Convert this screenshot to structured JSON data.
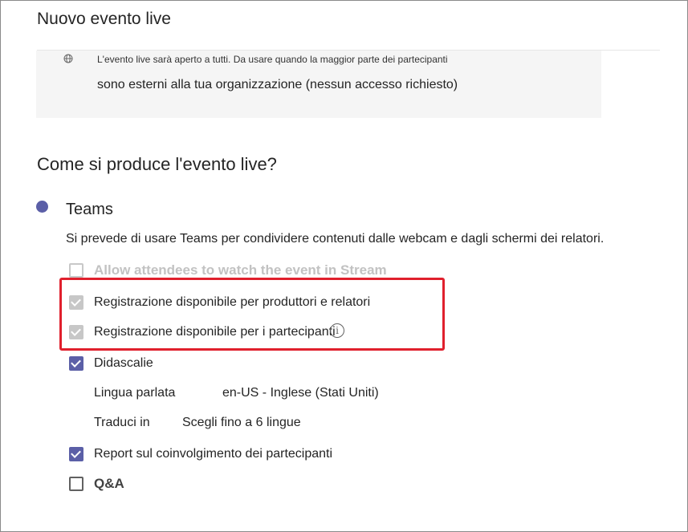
{
  "window": {
    "title": "Nuovo evento live"
  },
  "permissions": {
    "icon": "globe-icon",
    "description_line1": "L'evento live sarà aperto a tutti. Da usare quando la maggior parte dei partecipanti",
    "description_line2": "sono esterni alla tua organizzazione (nessun accesso richiesto)"
  },
  "production": {
    "heading": "Come si produce l'evento live?",
    "selected_option": "Teams",
    "description": "Si prevede di usare Teams per condividere contenuti dalle webcam e dagli schermi dei relatori.",
    "options": {
      "stream": {
        "label": "Allow attendees to watch the event in Stream",
        "checked": false,
        "disabled": true
      },
      "recording_producers": {
        "label": "Registrazione disponibile per produttori e relatori",
        "checked": true,
        "disabled": true
      },
      "recording_attendees": {
        "label": "Registrazione disponibile per i partecipanti",
        "checked": true,
        "disabled": true,
        "info_icon": "info-icon"
      },
      "captions": {
        "label": "Didascalie",
        "checked": true
      },
      "report": {
        "label": "Report sul coinvolgimento dei partecipanti",
        "checked": true
      },
      "qa": {
        "label": "Q&A",
        "checked": false
      }
    },
    "captions_settings": {
      "spoken_language_label": "Lingua parlata",
      "spoken_language_value": "en-US - Inglese (Stati Uniti)",
      "translate_label": "Traduci in",
      "translate_value": "Scegli fino a 6 lingue"
    }
  },
  "colors": {
    "accent": "#5b5fa7",
    "highlight": "#e0202d",
    "disabled_check": "#c7c7c7"
  }
}
